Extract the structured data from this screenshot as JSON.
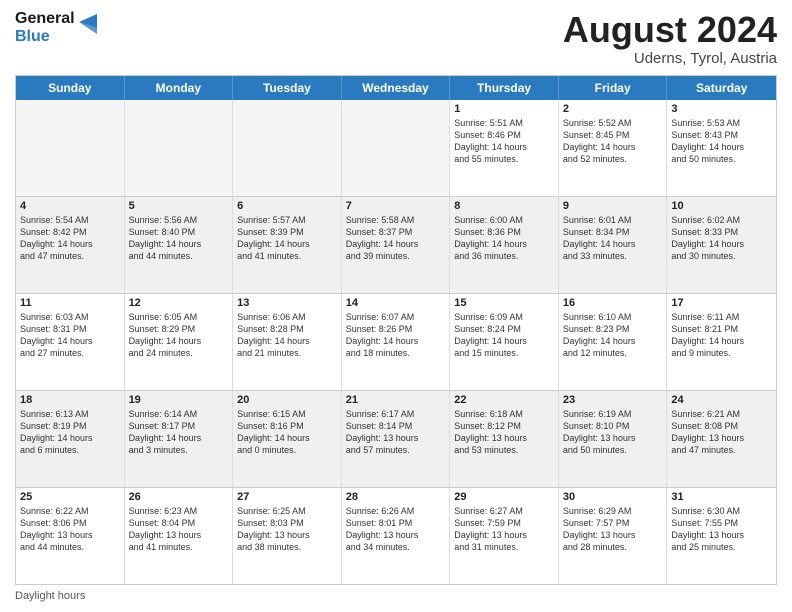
{
  "logo": {
    "text_general": "General",
    "text_blue": "Blue"
  },
  "title": "August 2024",
  "subtitle": "Uderns, Tyrol, Austria",
  "header_days": [
    "Sunday",
    "Monday",
    "Tuesday",
    "Wednesday",
    "Thursday",
    "Friday",
    "Saturday"
  ],
  "weeks": [
    [
      {
        "day": "",
        "info": "",
        "empty": true
      },
      {
        "day": "",
        "info": "",
        "empty": true
      },
      {
        "day": "",
        "info": "",
        "empty": true
      },
      {
        "day": "",
        "info": "",
        "empty": true
      },
      {
        "day": "1",
        "info": "Sunrise: 5:51 AM\nSunset: 8:46 PM\nDaylight: 14 hours\nand 55 minutes.",
        "empty": false
      },
      {
        "day": "2",
        "info": "Sunrise: 5:52 AM\nSunset: 8:45 PM\nDaylight: 14 hours\nand 52 minutes.",
        "empty": false
      },
      {
        "day": "3",
        "info": "Sunrise: 5:53 AM\nSunset: 8:43 PM\nDaylight: 14 hours\nand 50 minutes.",
        "empty": false
      }
    ],
    [
      {
        "day": "4",
        "info": "Sunrise: 5:54 AM\nSunset: 8:42 PM\nDaylight: 14 hours\nand 47 minutes.",
        "empty": false
      },
      {
        "day": "5",
        "info": "Sunrise: 5:56 AM\nSunset: 8:40 PM\nDaylight: 14 hours\nand 44 minutes.",
        "empty": false
      },
      {
        "day": "6",
        "info": "Sunrise: 5:57 AM\nSunset: 8:39 PM\nDaylight: 14 hours\nand 41 minutes.",
        "empty": false
      },
      {
        "day": "7",
        "info": "Sunrise: 5:58 AM\nSunset: 8:37 PM\nDaylight: 14 hours\nand 39 minutes.",
        "empty": false
      },
      {
        "day": "8",
        "info": "Sunrise: 6:00 AM\nSunset: 8:36 PM\nDaylight: 14 hours\nand 36 minutes.",
        "empty": false
      },
      {
        "day": "9",
        "info": "Sunrise: 6:01 AM\nSunset: 8:34 PM\nDaylight: 14 hours\nand 33 minutes.",
        "empty": false
      },
      {
        "day": "10",
        "info": "Sunrise: 6:02 AM\nSunset: 8:33 PM\nDaylight: 14 hours\nand 30 minutes.",
        "empty": false
      }
    ],
    [
      {
        "day": "11",
        "info": "Sunrise: 6:03 AM\nSunset: 8:31 PM\nDaylight: 14 hours\nand 27 minutes.",
        "empty": false
      },
      {
        "day": "12",
        "info": "Sunrise: 6:05 AM\nSunset: 8:29 PM\nDaylight: 14 hours\nand 24 minutes.",
        "empty": false
      },
      {
        "day": "13",
        "info": "Sunrise: 6:06 AM\nSunset: 8:28 PM\nDaylight: 14 hours\nand 21 minutes.",
        "empty": false
      },
      {
        "day": "14",
        "info": "Sunrise: 6:07 AM\nSunset: 8:26 PM\nDaylight: 14 hours\nand 18 minutes.",
        "empty": false
      },
      {
        "day": "15",
        "info": "Sunrise: 6:09 AM\nSunset: 8:24 PM\nDaylight: 14 hours\nand 15 minutes.",
        "empty": false
      },
      {
        "day": "16",
        "info": "Sunrise: 6:10 AM\nSunset: 8:23 PM\nDaylight: 14 hours\nand 12 minutes.",
        "empty": false
      },
      {
        "day": "17",
        "info": "Sunrise: 6:11 AM\nSunset: 8:21 PM\nDaylight: 14 hours\nand 9 minutes.",
        "empty": false
      }
    ],
    [
      {
        "day": "18",
        "info": "Sunrise: 6:13 AM\nSunset: 8:19 PM\nDaylight: 14 hours\nand 6 minutes.",
        "empty": false
      },
      {
        "day": "19",
        "info": "Sunrise: 6:14 AM\nSunset: 8:17 PM\nDaylight: 14 hours\nand 3 minutes.",
        "empty": false
      },
      {
        "day": "20",
        "info": "Sunrise: 6:15 AM\nSunset: 8:16 PM\nDaylight: 14 hours\nand 0 minutes.",
        "empty": false
      },
      {
        "day": "21",
        "info": "Sunrise: 6:17 AM\nSunset: 8:14 PM\nDaylight: 13 hours\nand 57 minutes.",
        "empty": false
      },
      {
        "day": "22",
        "info": "Sunrise: 6:18 AM\nSunset: 8:12 PM\nDaylight: 13 hours\nand 53 minutes.",
        "empty": false
      },
      {
        "day": "23",
        "info": "Sunrise: 6:19 AM\nSunset: 8:10 PM\nDaylight: 13 hours\nand 50 minutes.",
        "empty": false
      },
      {
        "day": "24",
        "info": "Sunrise: 6:21 AM\nSunset: 8:08 PM\nDaylight: 13 hours\nand 47 minutes.",
        "empty": false
      }
    ],
    [
      {
        "day": "25",
        "info": "Sunrise: 6:22 AM\nSunset: 8:06 PM\nDaylight: 13 hours\nand 44 minutes.",
        "empty": false
      },
      {
        "day": "26",
        "info": "Sunrise: 6:23 AM\nSunset: 8:04 PM\nDaylight: 13 hours\nand 41 minutes.",
        "empty": false
      },
      {
        "day": "27",
        "info": "Sunrise: 6:25 AM\nSunset: 8:03 PM\nDaylight: 13 hours\nand 38 minutes.",
        "empty": false
      },
      {
        "day": "28",
        "info": "Sunrise: 6:26 AM\nSunset: 8:01 PM\nDaylight: 13 hours\nand 34 minutes.",
        "empty": false
      },
      {
        "day": "29",
        "info": "Sunrise: 6:27 AM\nSunset: 7:59 PM\nDaylight: 13 hours\nand 31 minutes.",
        "empty": false
      },
      {
        "day": "30",
        "info": "Sunrise: 6:29 AM\nSunset: 7:57 PM\nDaylight: 13 hours\nand 28 minutes.",
        "empty": false
      },
      {
        "day": "31",
        "info": "Sunrise: 6:30 AM\nSunset: 7:55 PM\nDaylight: 13 hours\nand 25 minutes.",
        "empty": false
      }
    ]
  ],
  "footer": "Daylight hours"
}
